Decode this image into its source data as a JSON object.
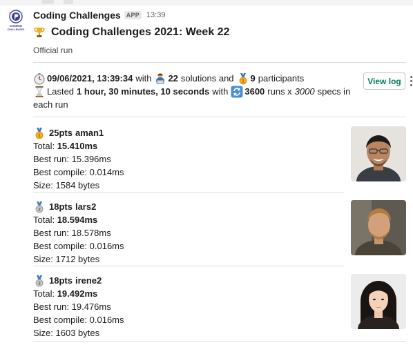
{
  "app": {
    "bot_name": "Coding Challenges",
    "badge": "APP",
    "timestamp": "13:39",
    "avatar_text": "CODING CHALLENGES"
  },
  "message": {
    "title_icon": "trophy-icon",
    "title": "Coding Challenges 2021: Week 22",
    "subtitle": "Official run"
  },
  "summary": {
    "date": "09/06/2021, 13:39:34",
    "with_text": "with",
    "solutions_count": "22",
    "solutions_text": "solutions and",
    "participants_count": "9",
    "participants_text": "participants",
    "lasted_text": "Lasted",
    "duration": "1 hour, 30 minutes, 10 seconds",
    "with_text2": "with",
    "runs_count": "3600",
    "runs_text": "runs x",
    "specs_count": "3000",
    "specs_text": "specs in",
    "each_run": "each run",
    "icons": [
      "stopwatch-icon",
      "technologist-icon",
      "medal-icon",
      "hourglass-icon",
      "repeat-icon"
    ]
  },
  "actions": {
    "view_log": "View log"
  },
  "leaderboard": [
    {
      "medal": "gold-medal-icon",
      "points": "25pts",
      "name": "aman1",
      "total_label": "Total:",
      "total": "15.410ms",
      "best_run": "Best run: 15.396ms",
      "best_compile": "Best compile: 0.014ms",
      "size": "Size: 1584 bytes"
    },
    {
      "medal": "silver-medal-icon",
      "points": "18pts",
      "name": "lars2",
      "total_label": "Total:",
      "total": "18.594ms",
      "best_run": "Best run: 18.578ms",
      "best_compile": "Best compile: 0.016ms",
      "size": "Size: 1712 bytes"
    },
    {
      "medal": "silver-medal-icon",
      "points": "18pts",
      "name": "irene2",
      "total_label": "Total:",
      "total": "19.492ms",
      "best_run": "Best run: 19.476ms",
      "best_compile": "Best compile: 0.016ms",
      "size": "Size: 1603 bytes"
    }
  ],
  "colors": {
    "accent": "#007a5a",
    "gold": "#f2b01e",
    "silver": "#a8a8a8",
    "divider": "#dddddd"
  }
}
